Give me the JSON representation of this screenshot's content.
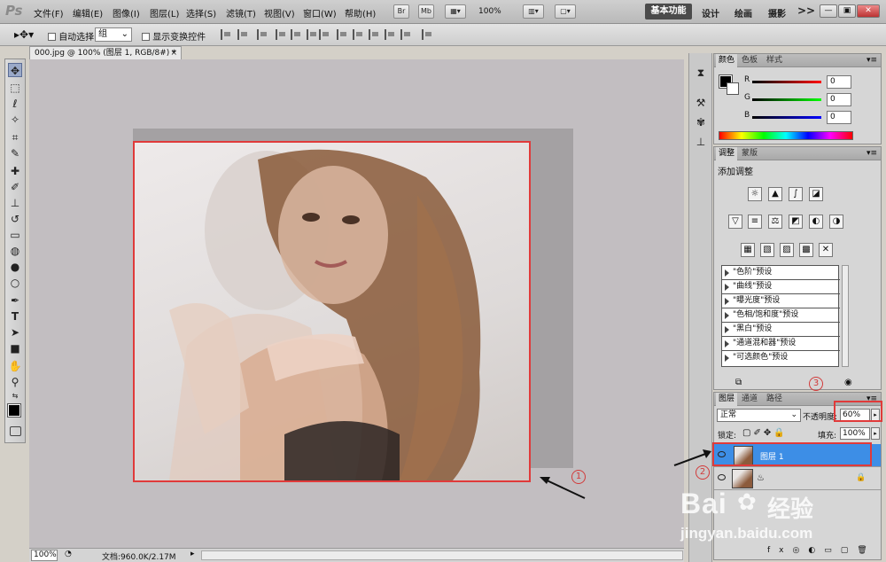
{
  "app": {
    "logo": "Ps"
  },
  "menu": [
    "文件(F)",
    "编辑(E)",
    "图像(I)",
    "图层(L)",
    "选择(S)",
    "滤镜(T)",
    "视图(V)",
    "窗口(W)",
    "帮助(H)"
  ],
  "topbar": {
    "br_label": "Br",
    "mb_label": "Mb",
    "zoom_label": "100%"
  },
  "workspaces": {
    "active": "基本功能",
    "others": [
      "设计",
      "绘画",
      "摄影"
    ],
    "more": ">>"
  },
  "window_controls": {
    "minimize": "—",
    "restore": "▣",
    "close": "✕"
  },
  "options": {
    "auto_select_label": "自动选择:",
    "auto_select_value": "组",
    "transform_label": "显示变换控件"
  },
  "document": {
    "tab_title": "000.jpg @ 100% (图层 1, RGB/8#) *",
    "close": "×"
  },
  "status": {
    "zoom": "100%",
    "doc_size": "文档:960.0K/2.17M"
  },
  "color_panel": {
    "tabs": [
      "颜色",
      "色板",
      "样式"
    ],
    "sliders": [
      {
        "label": "R",
        "value": "0",
        "gradient": [
          "#000000",
          "#ff0000"
        ]
      },
      {
        "label": "G",
        "value": "0",
        "gradient": [
          "#000000",
          "#00ff00"
        ]
      },
      {
        "label": "B",
        "value": "0",
        "gradient": [
          "#000000",
          "#0000ff"
        ]
      }
    ]
  },
  "adjust_panel": {
    "tabs": [
      "调整",
      "蒙版"
    ],
    "title": "添加调整",
    "icons_row1": [
      "☼",
      "▲",
      "∫",
      "◪"
    ],
    "icons_row2": [
      "▽",
      "≡",
      "⚖",
      "◩",
      "◐",
      "◑"
    ],
    "icons_row3": [
      "▦",
      "▧",
      "▨",
      "▩",
      "✕"
    ],
    "presets": [
      "\"色阶\"预设",
      "\"曲线\"预设",
      "\"曝光度\"预设",
      "\"色相/饱和度\"预设",
      "\"黑白\"预设",
      "\"通道混和器\"预设",
      "\"可选颜色\"预设"
    ]
  },
  "layers_panel": {
    "tabs": [
      "图层",
      "通道",
      "路径"
    ],
    "blend_mode": "正常",
    "opacity_label": "不透明度:",
    "opacity_value": "60%",
    "lock_label": "锁定:",
    "fill_label": "填充:",
    "fill_value": "100%",
    "layers": [
      {
        "name": "图层 1",
        "selected": true
      },
      {
        "name": "",
        "selected": false
      }
    ]
  },
  "annotations": [
    "1",
    "2",
    "3"
  ],
  "watermark": {
    "brand": "Bai",
    "brand_tail": "经验",
    "url": "jingyan.baidu.com"
  },
  "colors": {
    "accent_red": "#e03a3a",
    "selected_layer": "#3d8ee6",
    "canvas_bg": "#c2bec1"
  }
}
